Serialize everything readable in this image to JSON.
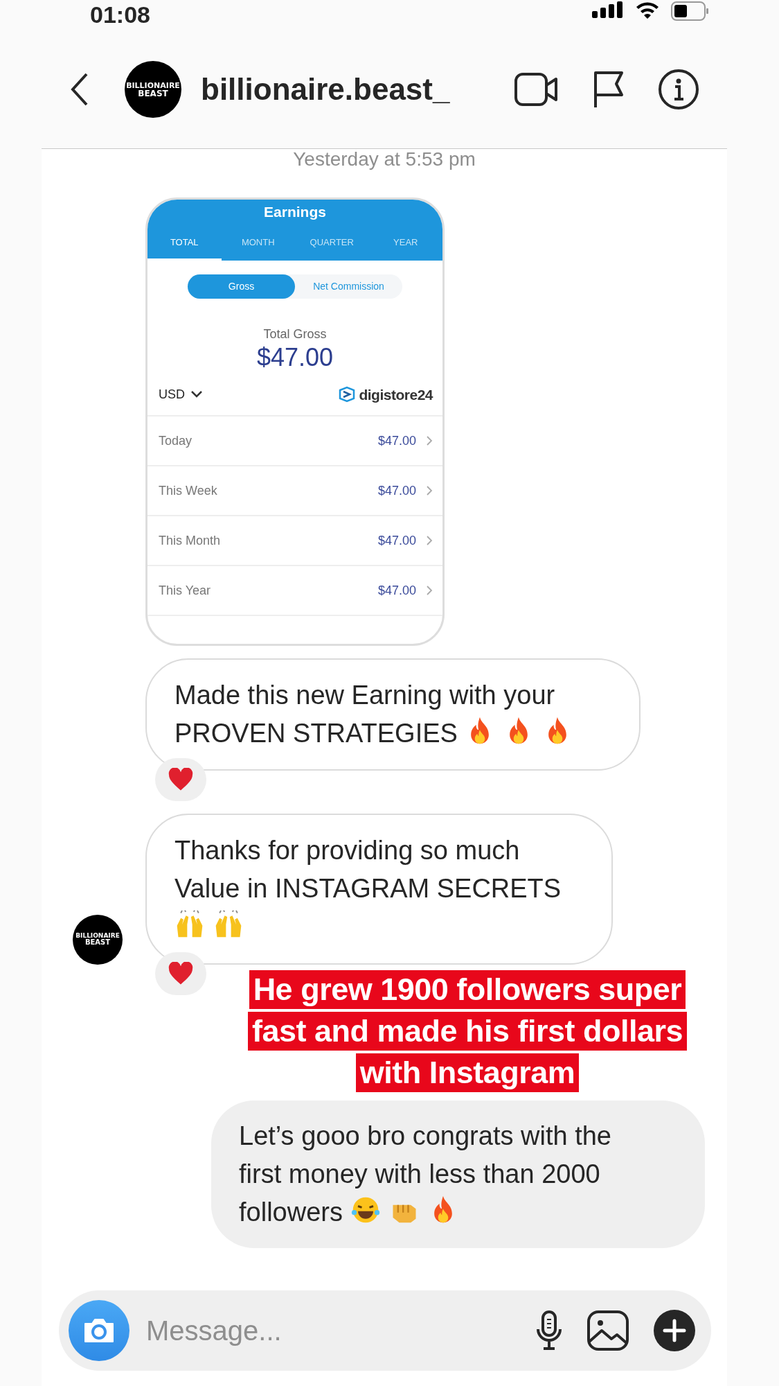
{
  "status_bar": {
    "time": "01:08"
  },
  "header": {
    "username": "billionaire.beast_",
    "avatar_text": [
      "BILLIONAIRE",
      "BEAST"
    ]
  },
  "timestamp": "Yesterday at 5:53 pm",
  "shared_screenshot": {
    "title": "Earnings",
    "tabs": [
      {
        "label": "TOTAL",
        "selected": true
      },
      {
        "label": "MONTH",
        "selected": false
      },
      {
        "label": "QUARTER",
        "selected": false
      },
      {
        "label": "YEAR",
        "selected": false
      }
    ],
    "toggle": [
      {
        "label": "Gross",
        "selected": true
      },
      {
        "label": "Net Commission",
        "selected": false
      }
    ],
    "total_label": "Total Gross",
    "total_value": "$47.00",
    "currency": "USD",
    "brand": "digistore24",
    "rows": [
      {
        "label": "Today",
        "value": "$47.00"
      },
      {
        "label": "This Week",
        "value": "$47.00"
      },
      {
        "label": "This Month",
        "value": "$47.00"
      },
      {
        "label": "This Year",
        "value": "$47.00"
      }
    ]
  },
  "messages": [
    {
      "kind": "incoming",
      "text": "Made this new Earning with your PROVEN STRATEGIES",
      "emojis": [
        {
          "kind": "fire"
        },
        {
          "kind": "fire"
        },
        {
          "kind": "fire"
        }
      ],
      "liked": true
    },
    {
      "kind": "incoming",
      "text": "Thanks for providing so much Value in INSTAGRAM SECRETS",
      "emojis": [
        {
          "kind": "hands"
        },
        {
          "kind": "hands"
        }
      ],
      "liked": true,
      "avatar_text": [
        "BILLIONAIRE",
        "BEAST"
      ]
    },
    {
      "kind": "caption",
      "lines": [
        "He grew 1900 followers super",
        "fast and made his first dollars",
        "with Instagram"
      ]
    },
    {
      "kind": "outgoing",
      "text": "Let’s gooo bro congrats with the first money with less than 2000 followers",
      "emojis": [
        {
          "kind": "laugh"
        },
        {
          "kind": "fist"
        },
        {
          "kind": "fire"
        }
      ]
    }
  ],
  "composer": {
    "placeholder": "Message..."
  }
}
